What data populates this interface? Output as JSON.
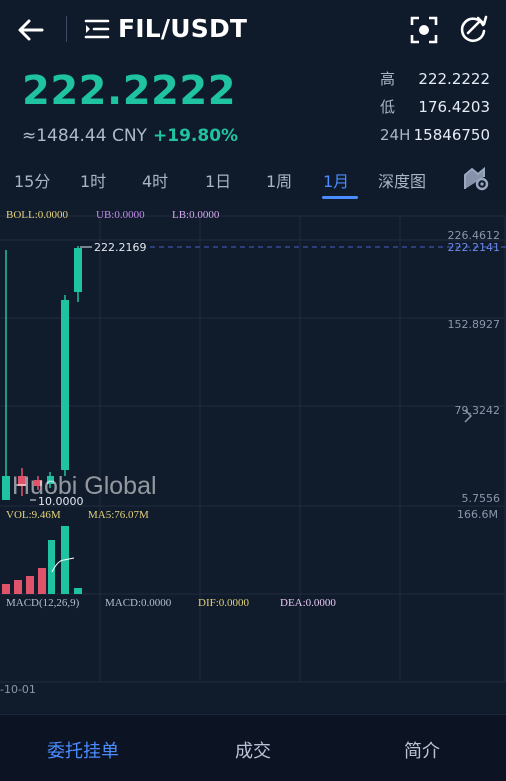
{
  "header": {
    "pair": "FIL/USDT"
  },
  "price": {
    "last": "222.2222",
    "cny": "≈1484.44 CNY",
    "change": "+19.80%",
    "high_label": "高",
    "high": "222.2222",
    "low_label": "低",
    "low": "176.4203",
    "vol_label": "24H",
    "vol": "15846750"
  },
  "tabs": [
    "15分",
    "1时",
    "4时",
    "1日",
    "1周",
    "1月",
    "深度图"
  ],
  "active_tab": "1月",
  "indicators": {
    "boll": "BOLL:0.0000",
    "ub": "UB:0.0000",
    "lb": "LB:0.0000",
    "vol": "VOL:9.46M",
    "ma5": "MA5:76.07M",
    "macd_params": "MACD(12,26,9)",
    "macd": "MACD:0.0000",
    "dif": "DIF:0.0000",
    "dea": "DEA:0.0000"
  },
  "axis": {
    "price_ticks": [
      "226.4612",
      "152.8927",
      "79.3242",
      "5.7556"
    ],
    "current_price_label": "222.2141",
    "high_marker": "222.2169",
    "low_marker": "10.0000",
    "volume_tick": "166.6M",
    "date_label": "-10-01"
  },
  "watermark": "Huobi Global",
  "colors": {
    "up": "#1fc3a2",
    "down": "#e0546b",
    "accent": "#4a8cff",
    "background": "#0f1a2b"
  },
  "footer": {
    "orders": "委托挂单",
    "trades": "成交",
    "intro": "简介"
  }
}
